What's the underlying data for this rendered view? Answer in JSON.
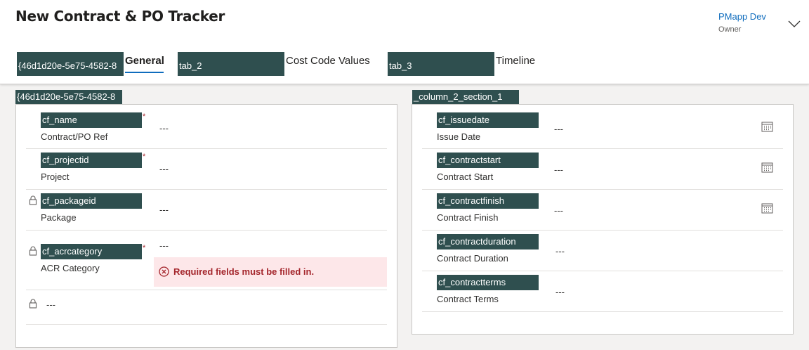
{
  "header": {
    "title": "New Contract & PO Tracker",
    "owner_name": "PMapp Dev",
    "owner_role": "Owner"
  },
  "tabs": {
    "block1": "{46d1d20e-5e75-4582-8",
    "general": "General",
    "block2": "tab_2",
    "cost_code_values": "Cost Code Values",
    "block3": "tab_3",
    "timeline": "Timeline"
  },
  "left_section": {
    "tag": "{46d1d20e-5e75-4582-8",
    "fields": [
      {
        "schema": "cf_name",
        "label": "Contract/PO Ref",
        "value": "---",
        "required": "*"
      },
      {
        "schema": "cf_projectid",
        "label": "Project",
        "value": "---",
        "required": "*"
      },
      {
        "schema": "cf_packageid",
        "label": "Package",
        "value": "---"
      },
      {
        "schema": "cf_acrcategory",
        "label": "ACR Category",
        "value": "---",
        "required": "*"
      },
      {
        "value": "---"
      }
    ],
    "error": "Required fields must be filled in."
  },
  "right_section": {
    "tag": "_column_2_section_1",
    "fields": [
      {
        "schema": "cf_issuedate",
        "label": "Issue Date",
        "value": "---",
        "icon": "calendar-icon"
      },
      {
        "schema": "cf_contractstart",
        "label": "Contract Start",
        "value": "---",
        "icon": "calendar-icon"
      },
      {
        "schema": "cf_contractfinish",
        "label": "Contract Finish",
        "value": "---",
        "icon": "calendar-icon"
      },
      {
        "schema": "cf_contractduration",
        "label": "Contract Duration",
        "value": "---"
      },
      {
        "schema": "cf_contractterms",
        "label": "Contract Terms",
        "value": "---"
      }
    ]
  },
  "colors": {
    "accent": "#0f6cbd",
    "tag_bg": "#2f4f4f",
    "error": "#a4262c",
    "error_bg": "#fde7e9"
  }
}
